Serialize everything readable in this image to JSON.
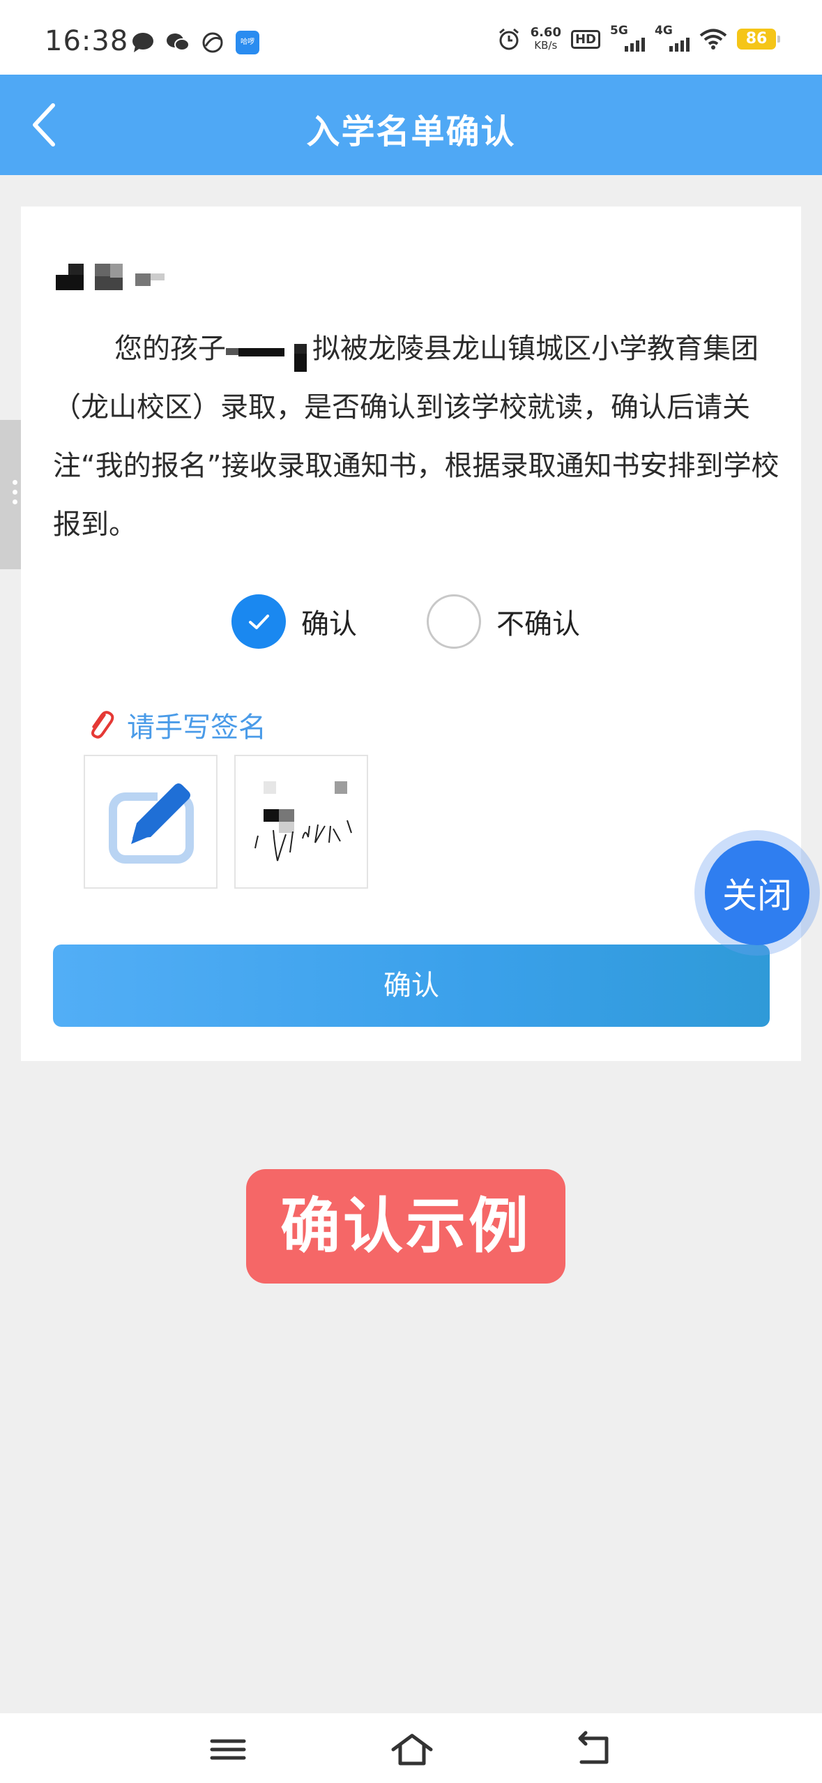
{
  "status_bar": {
    "time": "16:38",
    "net_speed": "6.60",
    "net_speed_unit": "KB/s",
    "hd_badge": "HD",
    "signal_5g": "5G",
    "signal_4g": "4G",
    "battery": "86",
    "app_badge": "哈啰"
  },
  "header": {
    "title": "入学名单确认",
    "back_icon": "chevron-left-icon",
    "color": "#4fa8f5"
  },
  "notice": {
    "text_before": "您的孩子",
    "text_after": "拟被龙陵县龙山镇城区小学教育集团（龙山校区）录取，是否确认到该学校就读，确认后请关注“我的报名”接收录取通知书，根据录取通知书安排到学校报到。"
  },
  "options": {
    "confirm": "确认",
    "no_confirm": "不确认",
    "selected": "confirm"
  },
  "signature": {
    "label": "请手写签名",
    "label_icon": "paperclip-icon",
    "edit_icon": "edit-pen-icon"
  },
  "submit_label": "确认",
  "close_button": "关闭",
  "example_badge": "确认示例",
  "colors": {
    "accent": "#1a88f0",
    "badge": "#f56767",
    "sign_label": "#4a9be8"
  }
}
